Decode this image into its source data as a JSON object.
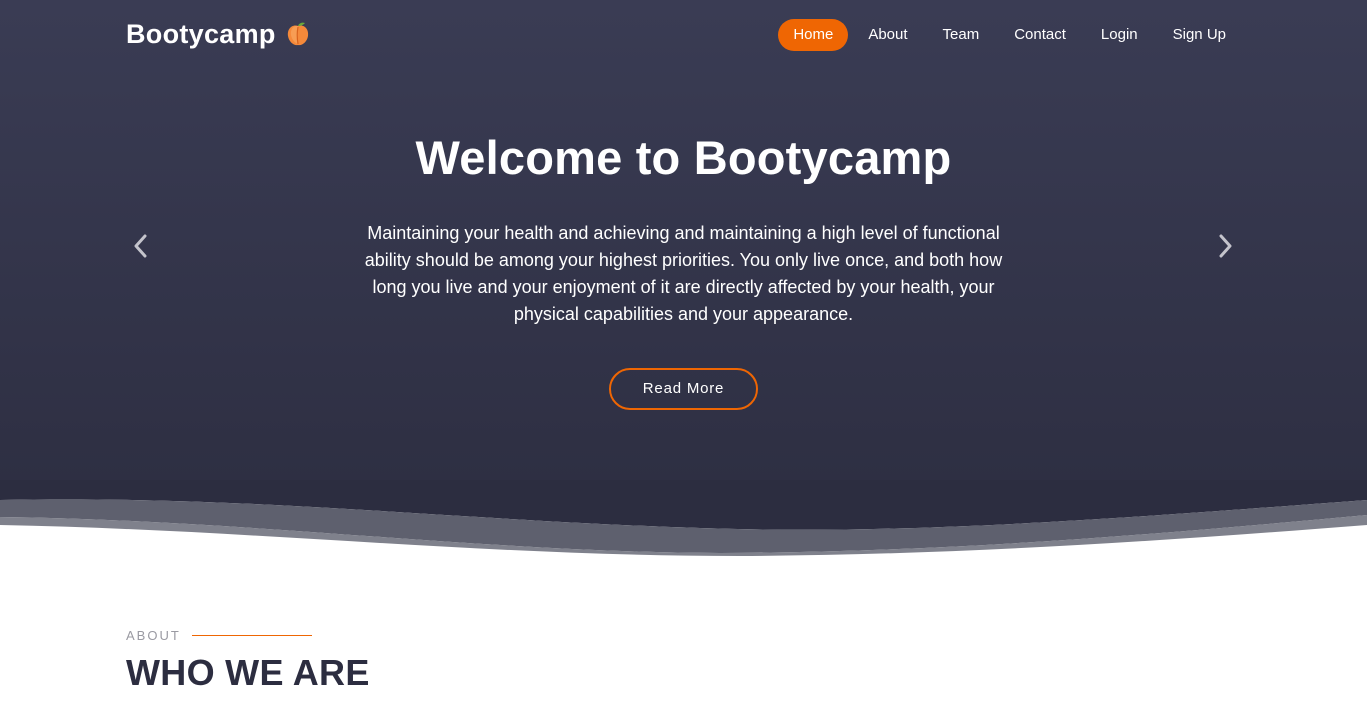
{
  "header": {
    "brand": "Bootycamp",
    "brand_icon": "peach-icon",
    "nav": [
      {
        "label": "Home",
        "active": true
      },
      {
        "label": "About",
        "active": false
      },
      {
        "label": "Team",
        "active": false
      },
      {
        "label": "Contact",
        "active": false
      },
      {
        "label": "Login",
        "active": false
      },
      {
        "label": "Sign Up",
        "active": false
      }
    ]
  },
  "hero": {
    "title": "Welcome to Bootycamp",
    "text": "Maintaining your health and achieving and maintaining a high level of functional ability should be among your highest priorities. You only live once, and both how long you live and your enjoyment of it are directly affected by your health, your physical capabilities and your appearance.",
    "cta_label": "Read More",
    "prev_icon": "chevron-left-icon",
    "next_icon": "chevron-right-icon"
  },
  "about": {
    "label": "ABOUT",
    "title": "WHO WE ARE"
  },
  "colors": {
    "accent": "#ef6603",
    "hero_bg": "#2c2d40",
    "text_light": "#ffffff",
    "heading_dark": "#2c2d40"
  }
}
